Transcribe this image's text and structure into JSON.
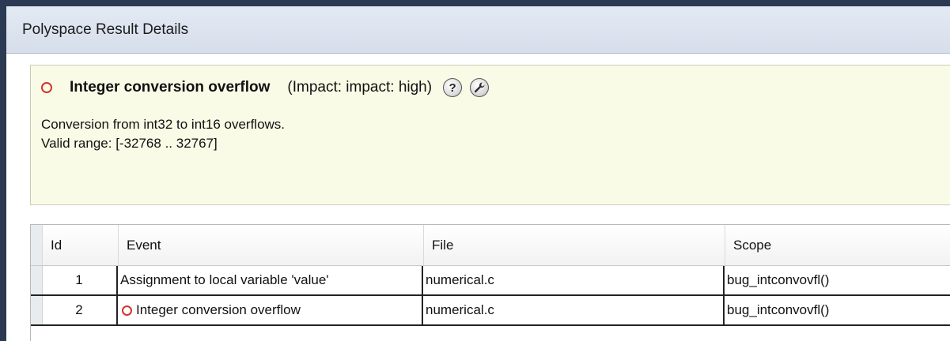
{
  "window": {
    "title": "Polyspace Result Details"
  },
  "detail": {
    "check_name": "Integer conversion overflow",
    "impact": "(Impact: impact: high)",
    "status_icon": "red-circle-icon",
    "help_icon": "question-icon",
    "tool_icon": "wrench-icon",
    "message_lines": [
      "Conversion from int32 to int16 overflows.",
      "Valid range: [-32768 .. 32767]"
    ]
  },
  "events_table": {
    "columns": [
      "Id",
      "Event",
      "File",
      "Scope"
    ],
    "rows": [
      {
        "id": "1",
        "event": "Assignment to local variable 'value'",
        "file": "numerical.c",
        "scope": "bug_intconvovfl()",
        "has_icon": false
      },
      {
        "id": "2",
        "event": "Integer conversion overflow",
        "file": "numerical.c",
        "scope": "bug_intconvovfl()",
        "has_icon": true
      }
    ]
  },
  "colors": {
    "frame": "#2b3a52",
    "titlebar": "#dbe2ee",
    "detail_bg": "#fafbe6",
    "status_red": "#d0352b"
  }
}
